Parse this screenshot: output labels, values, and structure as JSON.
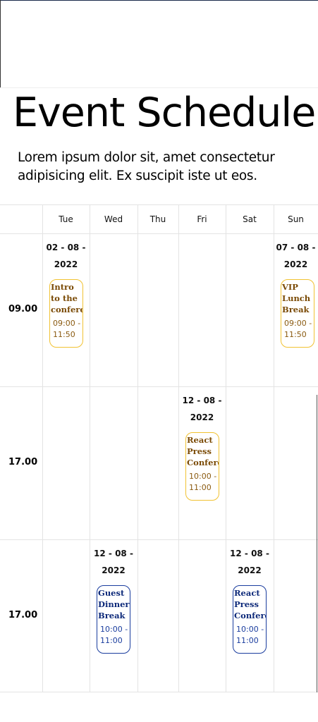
{
  "header": {
    "title": "Event Schedule",
    "description": "Lorem ipsum dolor sit, amet consectetur adipisicing elit. Ex suscipit iste ut eos."
  },
  "schedule": {
    "days": [
      "Tue",
      "Wed",
      "Thu",
      "Fri",
      "Sat",
      "Sun"
    ],
    "rows": [
      {
        "time": "09.00",
        "events": [
          {
            "day": "Tue",
            "date_part1": "02 - 08 -",
            "date_part2": "2022",
            "title": "Intro to the conference",
            "time_range": "09:00 - 11:50",
            "color": "gold"
          },
          {
            "day": "Sun",
            "date_part1": "07 - 08 -",
            "date_part2": "2022",
            "title": "VIP Lunch Break",
            "time_range": "09:00 - 11:50",
            "color": "gold"
          }
        ]
      },
      {
        "time": "17.00",
        "events": [
          {
            "day": "Fri",
            "date_part1": "12 - 08 -",
            "date_part2": "2022",
            "title": "React Press Conference",
            "time_range": "10:00 - 11:00",
            "color": "gold"
          }
        ]
      },
      {
        "time": "17.00",
        "events": [
          {
            "day": "Wed",
            "date_part1": "12 - 08 -",
            "date_part2": "2022",
            "title": "Guest Dinner Break",
            "time_range": "10:00 - 11:00",
            "color": "blue"
          },
          {
            "day": "Sat",
            "date_part1": "12 - 08 -",
            "date_part2": "2022",
            "title": "React Press Conference",
            "time_range": "10:00 - 11:00",
            "color": "blue"
          }
        ]
      }
    ]
  },
  "colors": {
    "gold_border": "#f1c232",
    "gold_text": "#7a4a05",
    "blue_border": "#1a3d9e",
    "blue_text": "#0e2a7a",
    "grid_line": "#e3e3e3"
  }
}
